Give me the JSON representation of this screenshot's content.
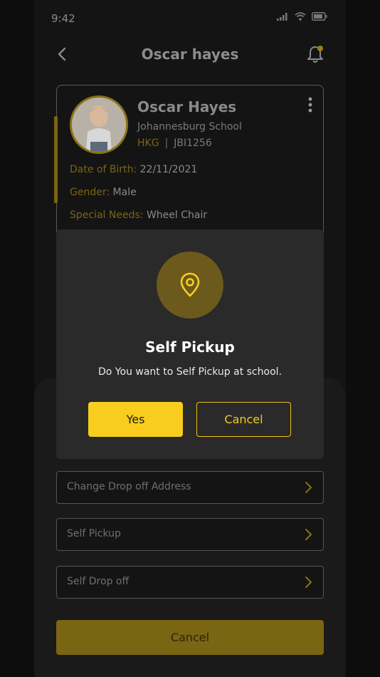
{
  "status_bar": {
    "time": "9:42",
    "icons": [
      "signal-icon",
      "wifi-icon",
      "battery-icon"
    ]
  },
  "header": {
    "title": "Oscar hayes",
    "back_icon": "chevron-left-icon",
    "bell_icon": "bell-icon"
  },
  "profile": {
    "name": "Oscar Hayes",
    "school": "Johannesburg School",
    "code_a": "HKG",
    "separator": "|",
    "code_b": "JBI1256",
    "dob_key": "Date of Birth:",
    "dob_value": "22/11/2021",
    "gender_key": "Gender:",
    "gender_value": "Male",
    "needs_key": "Special Needs:",
    "needs_value": "Wheel Chair"
  },
  "dialog": {
    "title": "Self Pickup",
    "message": "Do You want to Self Pickup at school.",
    "yes_label": "Yes",
    "cancel_label": "Cancel"
  },
  "options": [
    {
      "label": "Change Drop off Address"
    },
    {
      "label": "Self Pickup"
    },
    {
      "label": "Self Drop off"
    }
  ],
  "bottom_cancel": "Cancel",
  "colors": {
    "accent": "#f8cd1e",
    "dim_accent": "#7a6512",
    "background": "#141414",
    "dialog": "#2a2a2a"
  }
}
